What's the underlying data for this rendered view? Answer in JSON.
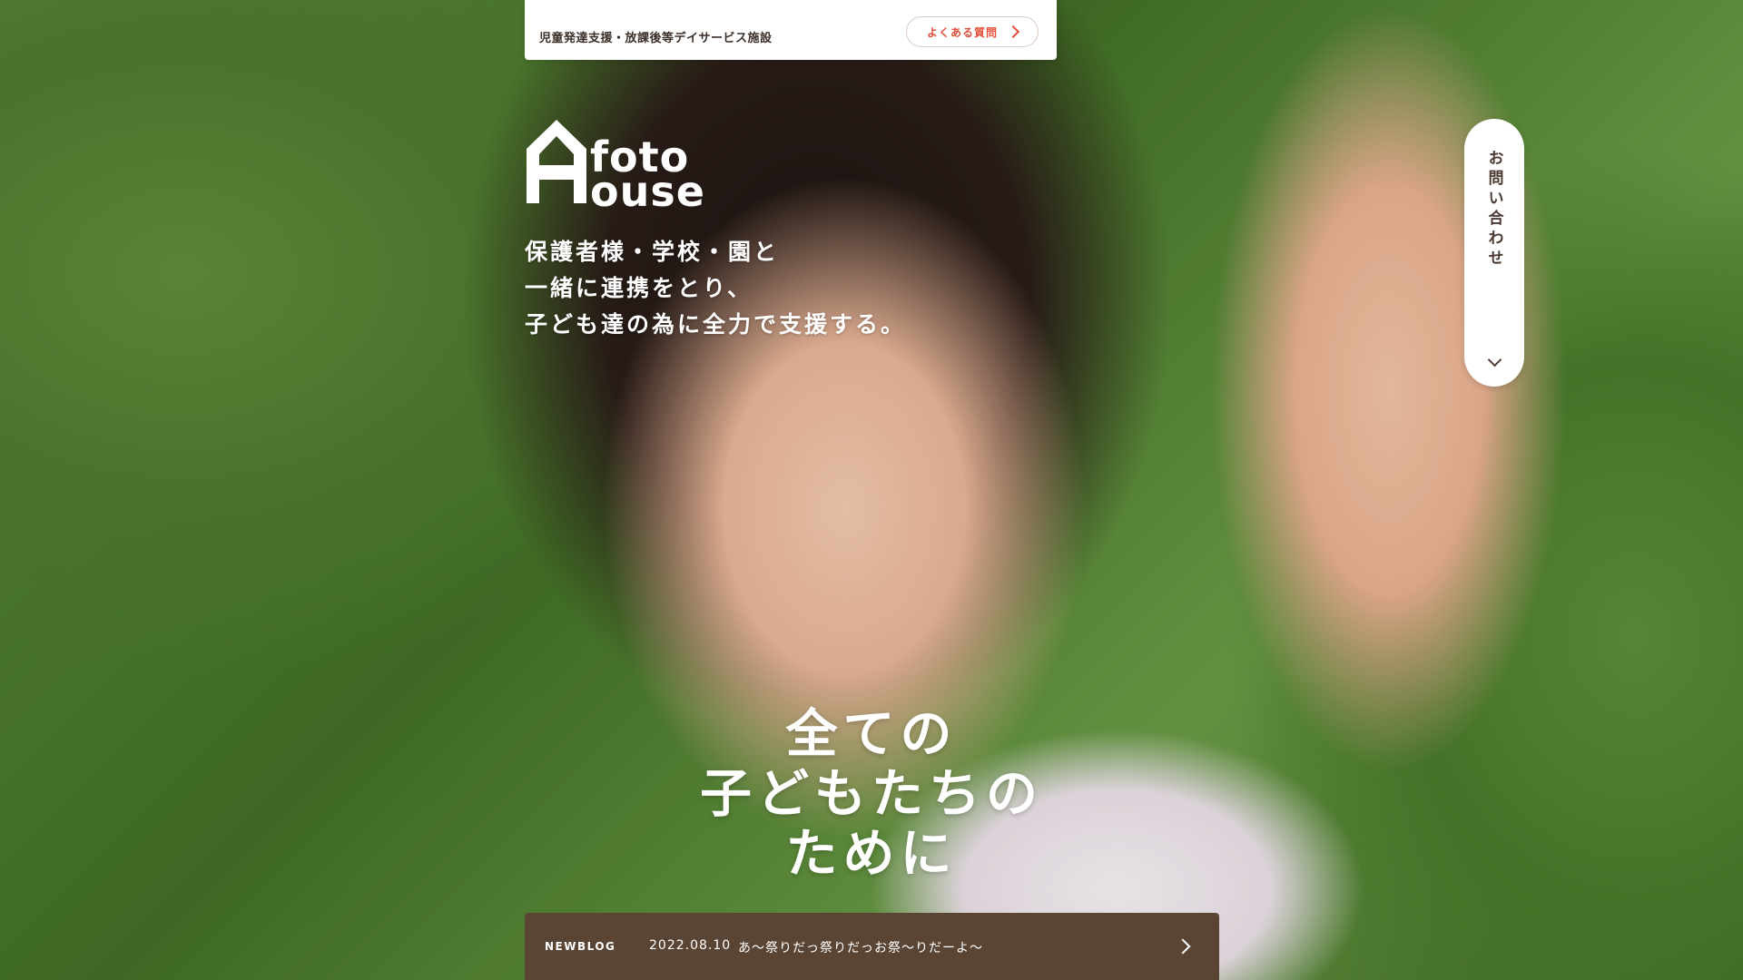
{
  "top_bar": {
    "facility_label": "児童発達支援・放課後等デイサービス施設",
    "faq_button": "よくある質問"
  },
  "logo": {
    "line1": "foto",
    "line2": "ouse",
    "icon": "house-icon"
  },
  "tagline": [
    "保護者様・学校・園と",
    "一緒に連携をとり、",
    "子ども達の為に全力で支援する。"
  ],
  "contact": {
    "label": "お問い合わせ",
    "icon": "chevron-down-icon"
  },
  "main_copy": [
    "全ての",
    "子どもたちの",
    "ために"
  ],
  "news": {
    "tag": "NEWBLOG",
    "date": "2022.08.10",
    "title": "あ〜祭りだっ祭りだっお祭〜りだーよ〜",
    "icon": "chevron-right-icon"
  },
  "colors": {
    "accent": "#e0503a",
    "news_bg": "#5a4535",
    "text_dark": "#4a3a32"
  }
}
